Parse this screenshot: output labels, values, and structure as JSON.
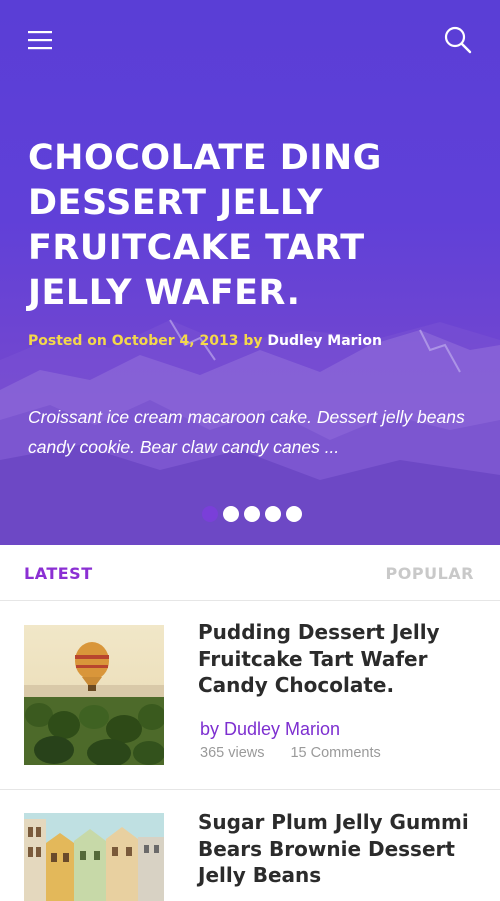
{
  "hero": {
    "title": "CHOCOLATE DING DESSERT JELLY FRUITCAKE TART JELLY WAFER.",
    "meta_prefix": "Posted on October 4, 2013 by",
    "author": "Dudley Marion",
    "excerpt": "Croissant ice cream macaroon cake. Dessert jelly beans candy cookie. Bear claw candy canes ...",
    "slides_total": 5,
    "slide_active": 1
  },
  "tabs": {
    "latest": "LATEST",
    "popular": "POPULAR"
  },
  "posts": [
    {
      "title": "Pudding Dessert Jelly Fruitcake Tart Wafer Candy Chocolate.",
      "author": "by Dudley Marion",
      "views": "365 views",
      "comments": "15 Comments"
    },
    {
      "title": "Sugar Plum Jelly Gummi Bears Brownie Dessert Jelly Beans"
    }
  ],
  "icons": {
    "menu": "hamburger-menu-icon",
    "search": "search-icon"
  },
  "colors": {
    "hero_overlay": "#5a3ed6",
    "accent_purple": "#8b2fd3",
    "meta_yellow": "#f4d84a",
    "tab_inactive": "#c9c9c9"
  }
}
